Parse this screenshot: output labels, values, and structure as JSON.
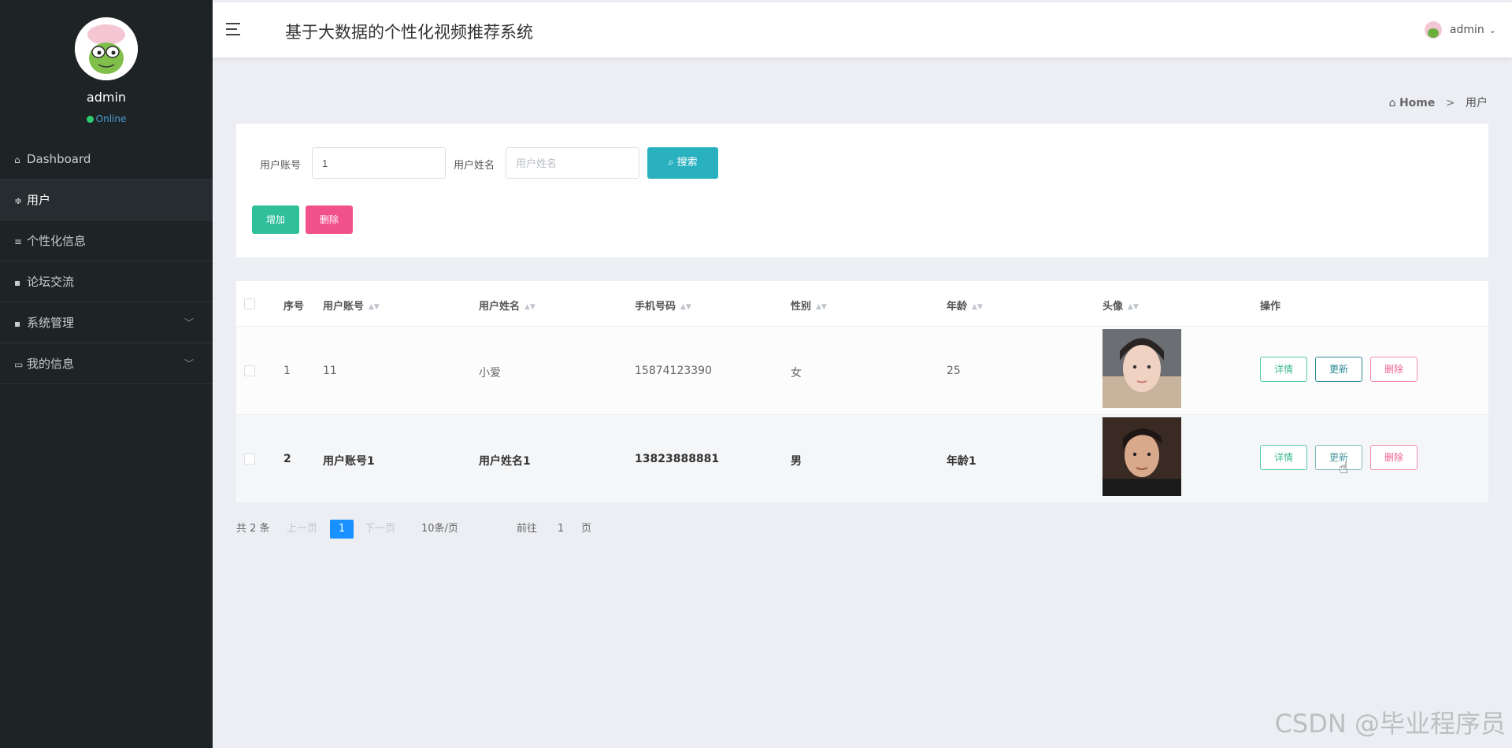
{
  "app": {
    "title": "基于大数据的个性化视频推荐系统"
  },
  "sidebar": {
    "username": "admin",
    "status": "Online",
    "items": [
      {
        "label": "Dashboard",
        "icon": "home-icon",
        "glyph": "⌂"
      },
      {
        "label": "用户",
        "icon": "sliders-icon",
        "glyph": "≑"
      },
      {
        "label": "个性化信息",
        "icon": "list-icon",
        "glyph": "≡"
      },
      {
        "label": "论坛交流",
        "icon": "grid-icon",
        "glyph": "▪"
      },
      {
        "label": "系统管理",
        "icon": "grid-icon",
        "glyph": "▪"
      },
      {
        "label": "我的信息",
        "icon": "card-icon",
        "glyph": "▭"
      }
    ]
  },
  "header": {
    "user": "admin"
  },
  "breadcrumb": {
    "home": "Home",
    "separator": ">",
    "current": "用户"
  },
  "search": {
    "account_label": "用户账号",
    "account_value": "1",
    "name_label": "用户姓名",
    "name_placeholder": "用户姓名",
    "search_button": "搜索",
    "add_button": "增加",
    "delete_button": "删除"
  },
  "table": {
    "columns": [
      "序号",
      "用户账号",
      "用户姓名",
      "手机号码",
      "性别",
      "年龄",
      "头像",
      "操作"
    ],
    "rows": [
      {
        "index": "1",
        "account": "11",
        "name": "小爱",
        "phone": "15874123390",
        "gender": "女",
        "age": "25"
      },
      {
        "index": "2",
        "account": "用户账号1",
        "name": "用户姓名1",
        "phone": "13823888881",
        "gender": "男",
        "age": "年龄1"
      }
    ],
    "actions": {
      "detail": "详情",
      "update": "更新",
      "remove": "删除"
    }
  },
  "pagination": {
    "total": "共 2 条",
    "prev": "上一页",
    "current_page": "1",
    "next": "下一页",
    "page_size": "10条/页",
    "goto_label": "前往",
    "goto_value": "1",
    "page_suffix": "页"
  },
  "watermark": "CSDN @毕业程序员",
  "colors": {
    "sidebar_bg": "#1e2426",
    "search_button": "#2ab1c0",
    "add_button": "#2fbf9b",
    "delete_button": "#f2508b",
    "page_active": "#1890ff"
  }
}
